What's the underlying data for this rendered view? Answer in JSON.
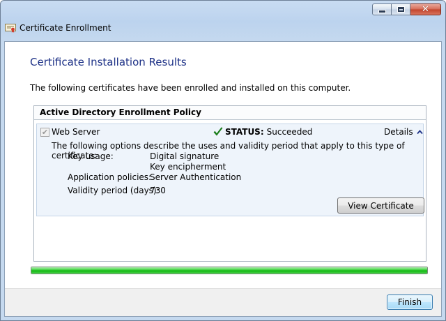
{
  "window": {
    "title": "Certificate Enrollment",
    "controls": {
      "minimize_icon": "minimize-icon",
      "maximize_icon": "maximize-icon",
      "close_icon": "close-icon",
      "close_glyph": "✕"
    }
  },
  "page": {
    "heading": "Certificate Installation Results",
    "intro": "The following certificates have been enrolled and installed on this computer."
  },
  "policy": {
    "name": "Active Directory Enrollment Policy",
    "certificate": {
      "checked": true,
      "name": "Web Server",
      "status_label": "STATUS:",
      "status_value": "Succeeded",
      "status_color": "#1a8a1a",
      "details_label": "Details",
      "description": "The following options describe the uses and validity period that apply to this type of certificate:",
      "properties": [
        {
          "label": "Key usage:",
          "values": [
            "Digital signature",
            "Key encipherment"
          ]
        },
        {
          "label": "Application policies:",
          "values": [
            "Server Authentication"
          ]
        },
        {
          "label": "Validity period (days):",
          "values": [
            "730"
          ]
        }
      ],
      "view_button": "View Certificate"
    }
  },
  "progress": {
    "percent": 100,
    "color": "#22c122"
  },
  "footer": {
    "finish_button": "Finish"
  },
  "colors": {
    "heading": "#1e3287",
    "panel": "#eef4fb"
  }
}
